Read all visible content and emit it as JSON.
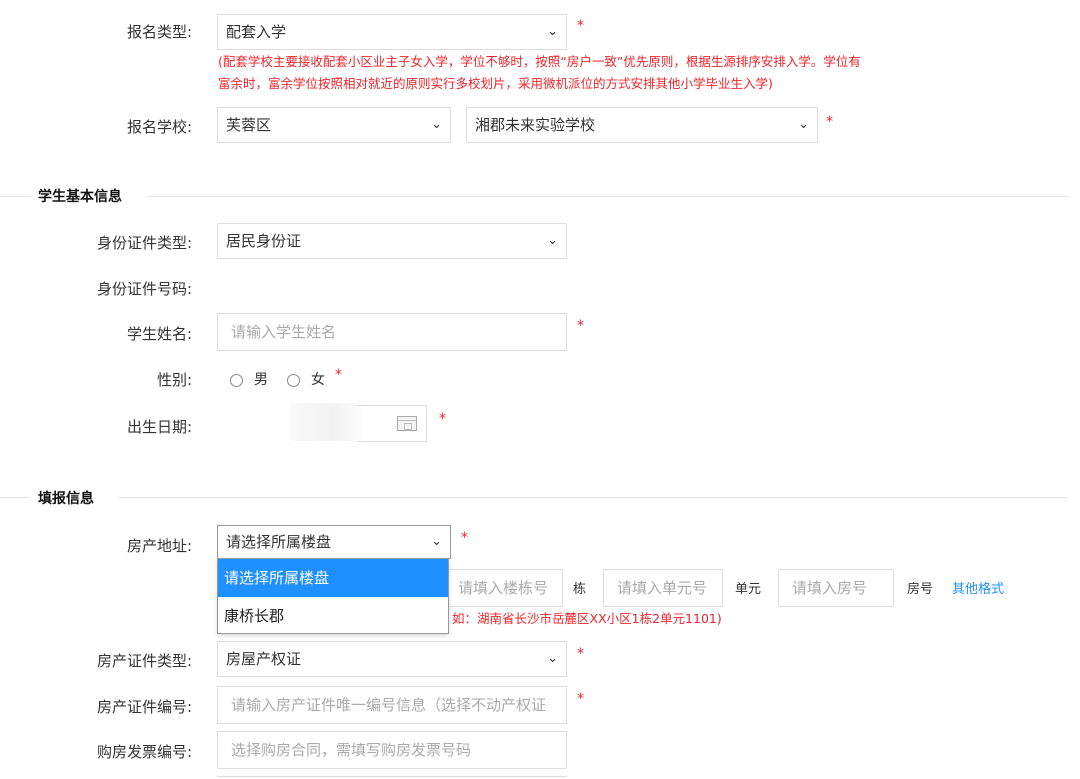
{
  "enroll_type": {
    "label": "报名类型:",
    "value": "配套入学",
    "hint_line1": "(配套学校主要接收配套小区业主子女入学，学位不够时，按照“房户一致”优先原则，根据生源排序安排入学。学位有",
    "hint_line2": "富余时，富余学位按照相对就近的原则实行多校划片，采用微机派位的方式安排其他小学毕业生入学)"
  },
  "enroll_school": {
    "label": "报名学校:",
    "district": "芙蓉区",
    "school": "湘郡未来实验学校"
  },
  "student_section": {
    "title": "学生基本信息",
    "id_type_label": "身份证件类型:",
    "id_type_value": "居民身份证",
    "id_number_label": "身份证件号码:",
    "name_label": "学生姓名:",
    "name_placeholder": "请输入学生姓名",
    "gender_label": "性别:",
    "gender_male": "男",
    "gender_female": "女",
    "birth_label": "出生日期:"
  },
  "fill_section": {
    "title": "填报信息",
    "property_label": "房产地址:",
    "property_value": "请选择所属楼盘",
    "building_placeholder": "请填入楼栋号",
    "building_unit": "栋",
    "unit_placeholder": "请填入单元号",
    "unit_unit": "单元",
    "room_placeholder": "请填入房号",
    "room_unit": "房号",
    "other_format": "其他格式",
    "address_hint": "如：湖南省长沙市岳麓区XX小区1栋2单元1101)",
    "dropdown_options": [
      "请选择所属楼盘",
      "康桥长郡"
    ],
    "cert_type_label": "房产证件类型:",
    "cert_type_value": "房屋产权证",
    "cert_no_label": "房产证件编号:",
    "cert_no_placeholder": "请输入房产证件唯一编号信息（选择不动产权证",
    "invoice_label": "购房发票编号:",
    "invoice_placeholder": "选择购房合同，需填写购房发票号码"
  },
  "required_mark": "*",
  "colors": {
    "accent": "#1e90ff",
    "required": "#f0232a",
    "link": "#1e90ff"
  }
}
